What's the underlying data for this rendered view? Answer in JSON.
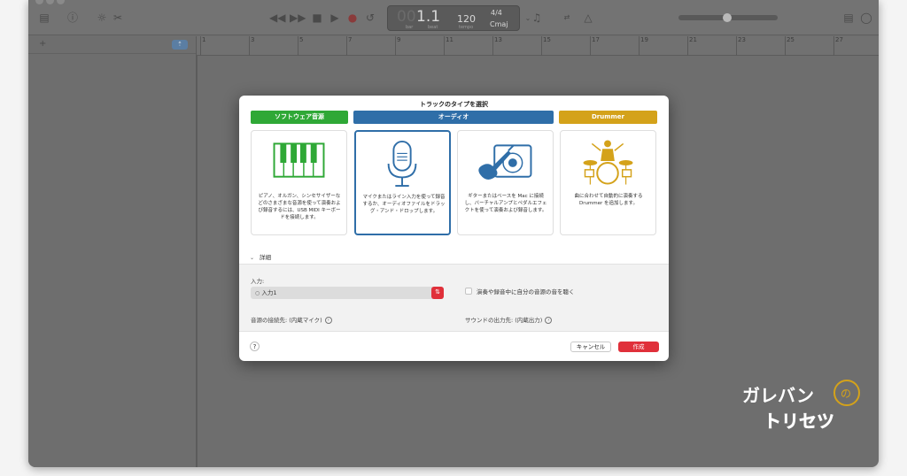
{
  "toolbar": {
    "lcd": {
      "position": "1.1",
      "position_dim": "00",
      "bar_label": "bar",
      "beat_label": "beat",
      "tempo": "120",
      "tempo_label": "tempo",
      "time_signature": "4/4",
      "key": "Cmaj"
    }
  },
  "ruler": {
    "bars": [
      "1",
      "3",
      "5",
      "7",
      "9",
      "11",
      "13",
      "15",
      "17",
      "19",
      "21",
      "23",
      "25",
      "27"
    ]
  },
  "dialog": {
    "title": "トラックのタイプを選択",
    "categories": [
      {
        "label": "ソフトウェア音源",
        "color": "#2fa836"
      },
      {
        "label": "オーディオ",
        "color": "#2f6ea8"
      },
      {
        "label": "Drummer",
        "color": "#d4a21a"
      }
    ],
    "cards": [
      {
        "icon": "piano-keyboard-icon",
        "description": "ピアノ、オルガン、シンセサイザーなどのさまざまな音源を使って演奏および録音するには、USB MIDI キーボードを接続します。"
      },
      {
        "icon": "microphone-icon",
        "description": "マイクまたはライン入力を使って録音するか、オーディオファイルをドラッグ・アンド・ドロップします。"
      },
      {
        "icon": "guitar-amp-icon",
        "description": "ギターまたはベースを Mac に接続し、バーチャルアンプとペダルエフェクトを使って演奏および録音します。"
      },
      {
        "icon": "drummer-icon",
        "description": "曲に合わせて自動的に演奏する Drummer を追加します。"
      }
    ],
    "details_label": "詳細",
    "input_label": "入力:",
    "input_value": "入力1",
    "monitor_label": "演奏や録音中に自分の音源の音を聴く",
    "source_label": "音源の接続先: (内蔵マイク)",
    "output_label": "サウンドの出力先: (内蔵出力)",
    "help_label": "?",
    "cancel_label": "キャンセル",
    "create_label": "作成"
  },
  "logo": {
    "text_top": "ガレバン",
    "text_bottom": "トリセツ"
  },
  "colors": {
    "accent_red": "#e0303a",
    "audio_blue": "#2f6ea8",
    "drummer_gold": "#d4a21a",
    "software_green": "#2fa836"
  }
}
